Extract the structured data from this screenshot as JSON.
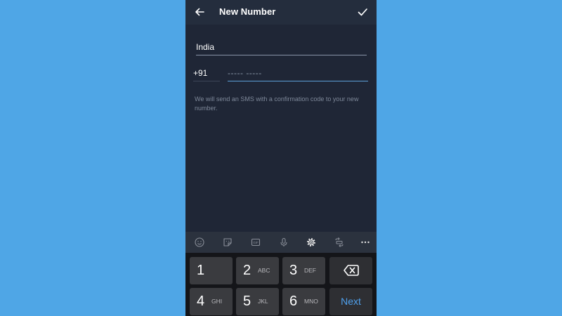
{
  "appbar": {
    "title": "New Number",
    "back_icon": "arrow-left-icon",
    "done_icon": "check-icon"
  },
  "form": {
    "country": "India",
    "country_code": "+91",
    "phone_value": "",
    "phone_placeholder": "----- -----",
    "info": "We will send an SMS with a confirmation code to your new number."
  },
  "keyboard_toolbar": [
    {
      "icon": "emoji-icon"
    },
    {
      "icon": "sticker-icon"
    },
    {
      "icon": "gif-icon",
      "label": "GIF"
    },
    {
      "icon": "microphone-icon"
    },
    {
      "icon": "settings-icon"
    },
    {
      "icon": "translate-icon"
    },
    {
      "icon": "more-icon"
    }
  ],
  "keyboard": {
    "keys": [
      {
        "num": "1",
        "letters": ""
      },
      {
        "num": "2",
        "letters": "ABC"
      },
      {
        "num": "3",
        "letters": "DEF"
      },
      {
        "num": "4",
        "letters": "GHI"
      },
      {
        "num": "5",
        "letters": "JKL"
      },
      {
        "num": "6",
        "letters": "MNO"
      }
    ],
    "next_label": "Next"
  },
  "colors": {
    "background": "#4FA6E6",
    "app_bg": "#1F2636",
    "appbar_bg": "#242D3D",
    "accent": "#5C9FD8",
    "keyboard_bg": "#141519",
    "key_bg": "#3A3B3F",
    "next_text": "#4FA0EC"
  }
}
